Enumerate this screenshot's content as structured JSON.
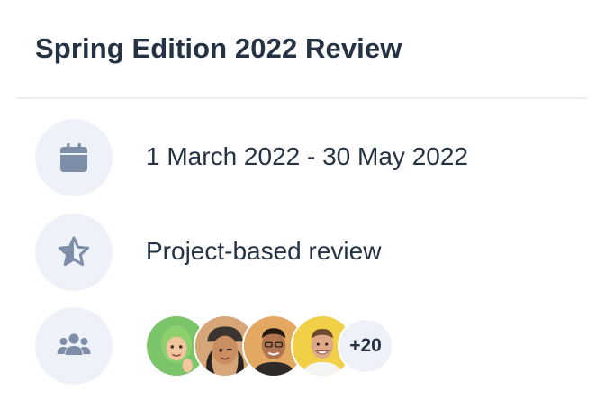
{
  "review": {
    "title": "Spring Edition 2022 Review",
    "details": [
      {
        "icon": "calendar-icon",
        "text": "1 March 2022 - 30 May 2022"
      },
      {
        "icon": "star-icon",
        "text": "Project-based review"
      },
      {
        "icon": "users-icon"
      }
    ],
    "participants": {
      "avatars": [
        "avatar-1",
        "avatar-2",
        "avatar-3",
        "avatar-4"
      ],
      "overflow_count": "+20"
    }
  },
  "colors": {
    "icon": "#7d8ea8",
    "icon_bg": "#eef2f8",
    "text": "#243244",
    "divider": "#eceff3"
  }
}
